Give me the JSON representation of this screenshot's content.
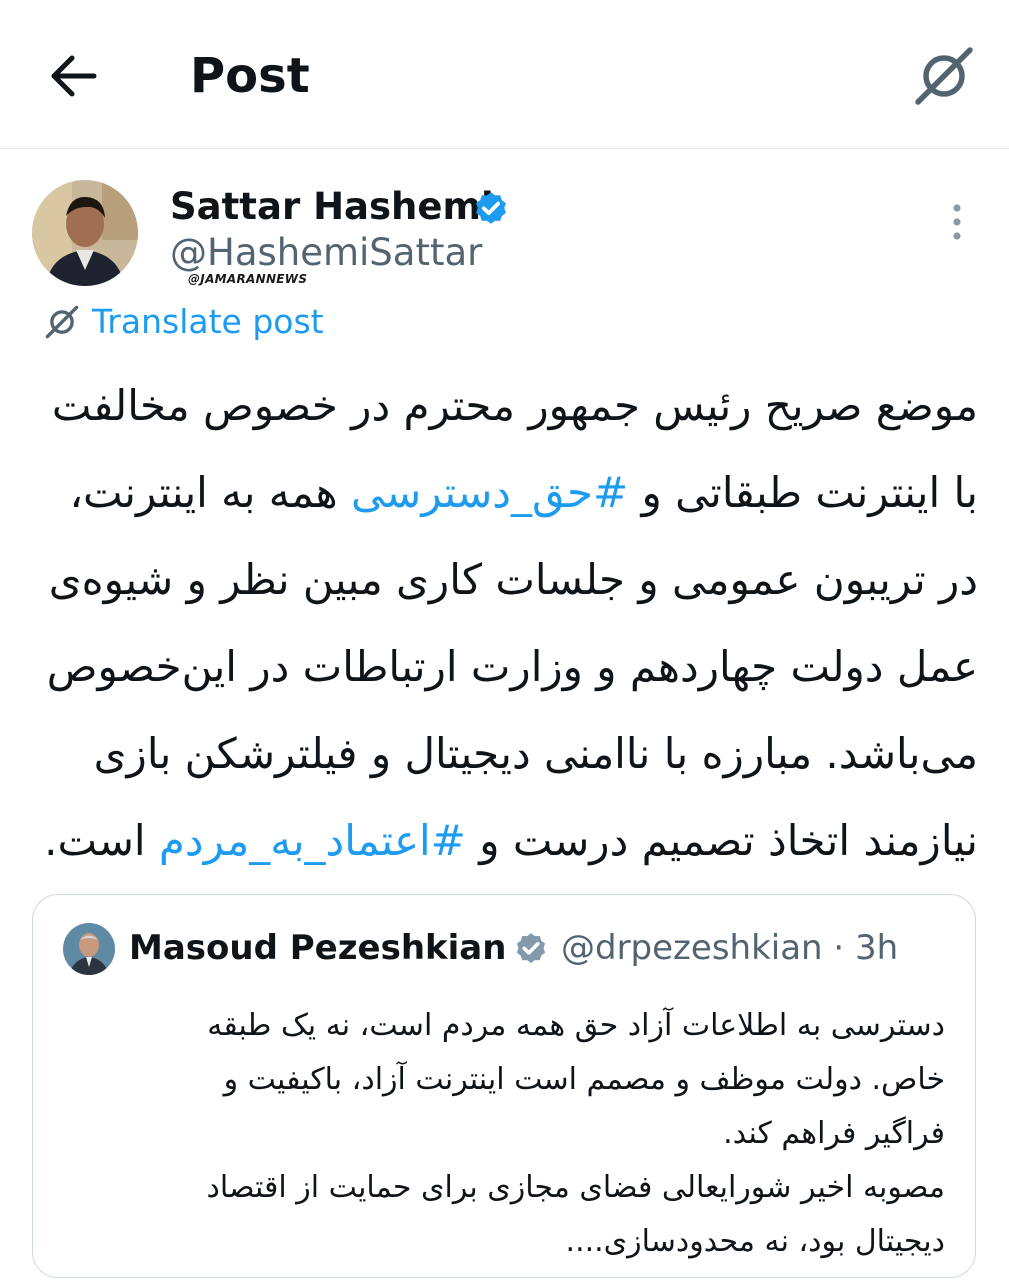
{
  "header": {
    "title": "Post",
    "back_icon": "arrow-left-icon",
    "translate_icon": "grok-translate-icon"
  },
  "post": {
    "author_name": "Sattar Hashemi",
    "author_handle": "@HashemiSattar",
    "verified_icon": "verified-badge-icon",
    "watermark": "@JAMARANNEWS",
    "more_icon": "more-vertical-icon",
    "translate_label": "Translate post",
    "text_lines": [
      [
        {
          "t": "موضع صریح رئیس جمهور محترم در خصوص مخالفت"
        }
      ],
      [
        {
          "t": "با اینترنت طبقاتی و "
        },
        {
          "t": "#حق_دسترسی",
          "tag": true
        },
        {
          "t": " همه به اینترنت،"
        }
      ],
      [
        {
          "t": "در تریبون عمومی و جلسات کاری مبین نظر و شیوه‌ی"
        }
      ],
      [
        {
          "t": "عمل دولت چهاردهم و وزارت ارتباطات در این‌خصوص"
        }
      ],
      [
        {
          "t": "می‌باشد. مبارزه با ناامنی دیجیتال و فیلترشکن بازی"
        }
      ],
      [
        {
          "t": "نیازمند اتخاذ تصمیم درست و "
        },
        {
          "t": "#اعتماد_به_مردم",
          "tag": true
        },
        {
          "t": " است."
        }
      ]
    ]
  },
  "quote": {
    "author_name": "Masoud Pezeshkian",
    "author_handle": "@drpezeshkian",
    "time": "3h",
    "verified_icon": "verified-gray-badge-icon",
    "text_lines": [
      "دسترسی به اطلاعات آزاد حق همه مردم است، نه یک طبقه",
      "خاص. دولت موظف و مصمم است اینترنت آزاد، باکیفیت و",
      "فراگیر فراهم کند.",
      "مصوبه اخیر شورایعالی فضای مجازی برای حمایت از اقتصاد",
      "دیجیتال بود، نه محدودسازی...."
    ]
  },
  "colors": {
    "link": "#1d9bf0",
    "secondary_text": "#536471",
    "border": "#cfd9de",
    "verified_blue": "#1d9bf0",
    "verified_gray": "#829aab"
  }
}
